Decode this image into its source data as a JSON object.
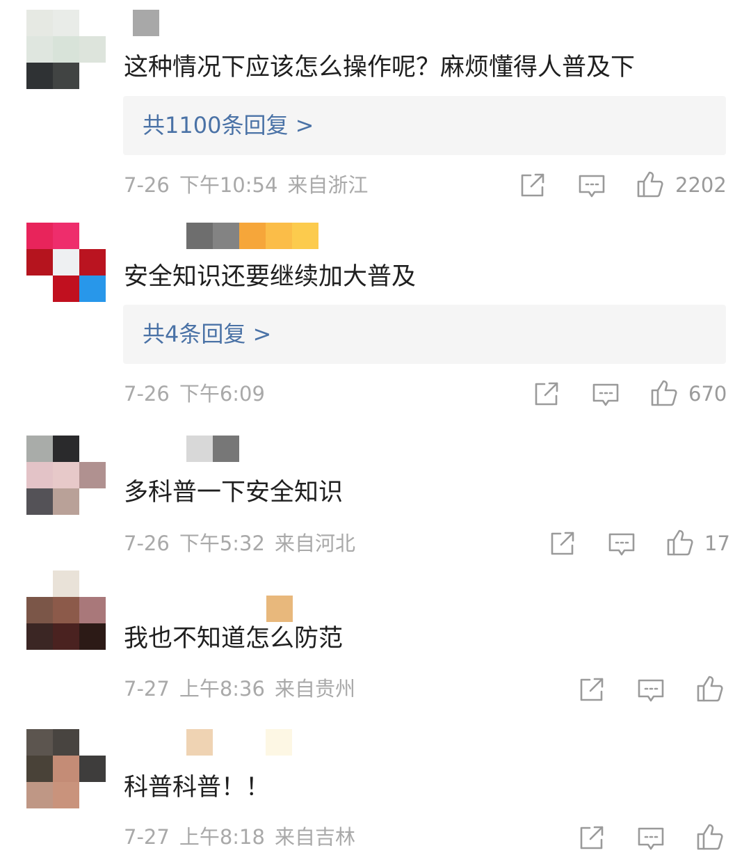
{
  "comments": [
    {
      "text": "这种情况下应该怎么操作呢？麻烦懂得人普及下",
      "reply_label": "共1100条回复 >",
      "date": "7-26",
      "time": "下午10:54",
      "location": "来自浙江",
      "likes": "2202"
    },
    {
      "text": "安全知识还要继续加大普及",
      "reply_label": "共4条回复 >",
      "date": "7-26",
      "time": "下午6:09",
      "location": "",
      "likes": "670"
    },
    {
      "text": "多科普一下安全知识",
      "date": "7-26",
      "time": "下午5:32",
      "location": "来自河北",
      "likes": "17"
    },
    {
      "text": "我也不知道怎么防范",
      "date": "7-27",
      "time": "上午8:36",
      "location": "来自贵州",
      "likes": ""
    },
    {
      "text": "科普科普！！",
      "date": "7-27",
      "time": "上午8:18",
      "location": "来自吉林",
      "likes": ""
    }
  ],
  "colors": {
    "reply_link": "#4a72a6",
    "meta_text": "#a9a9a9",
    "reply_bg": "#f5f5f5",
    "icon": "#9a9a9a"
  },
  "icons": [
    "share-icon",
    "comment-icon",
    "like-icon"
  ]
}
